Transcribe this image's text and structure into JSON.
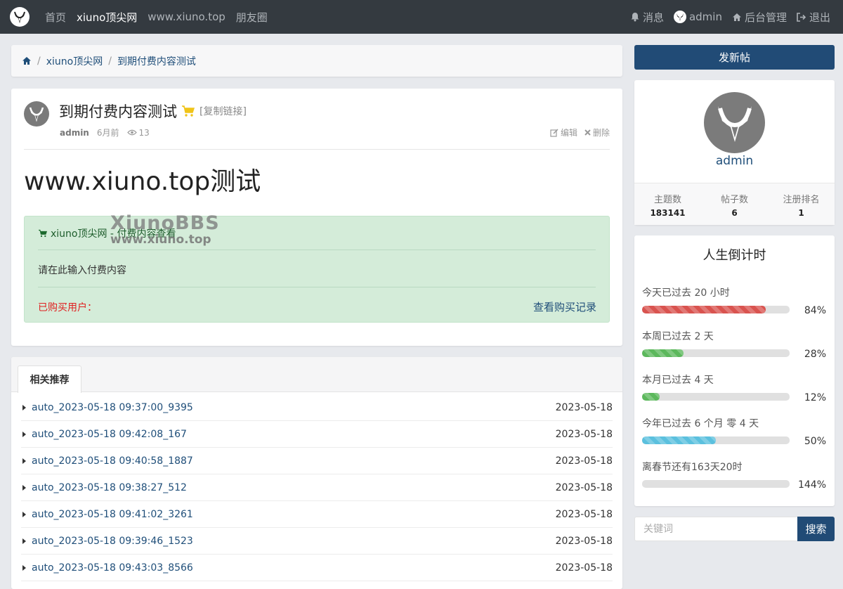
{
  "nav": {
    "logo_icon": "bull-logo-icon",
    "left": [
      "首页",
      "xiuno顶尖网",
      "www.xiuno.top",
      "朋友圈"
    ],
    "messages": "消息",
    "user": "admin",
    "admin": "后台管理",
    "logout": "退出"
  },
  "breadcrumb": {
    "site": "xiuno顶尖网",
    "current": "到期付费内容测试"
  },
  "post": {
    "title": "到期付费内容测试",
    "copy_link": "[复制链接]",
    "author": "admin",
    "time": "6月前",
    "views": "13",
    "edit": "编辑",
    "delete": "删除",
    "body_title": "www.xiuno.top测试",
    "pay": {
      "header": "xiuno顶尖网 - 付费内容查看",
      "content": "请在此输入付费内容",
      "buyers_label": "已购买用户：",
      "record_link": "查看购买记录"
    },
    "watermark": [
      "XiunoBBS",
      "www.xiuno.top"
    ]
  },
  "related": {
    "tab": "相关推荐",
    "items": [
      {
        "title": "auto_2023-05-18 09:37:00_9395",
        "date": "2023-05-18"
      },
      {
        "title": "auto_2023-05-18 09:42:08_167",
        "date": "2023-05-18"
      },
      {
        "title": "auto_2023-05-18 09:40:58_1887",
        "date": "2023-05-18"
      },
      {
        "title": "auto_2023-05-18 09:38:27_512",
        "date": "2023-05-18"
      },
      {
        "title": "auto_2023-05-18 09:41:02_3261",
        "date": "2023-05-18"
      },
      {
        "title": "auto_2023-05-18 09:39:46_1523",
        "date": "2023-05-18"
      },
      {
        "title": "auto_2023-05-18 09:43:03_8566",
        "date": "2023-05-18"
      }
    ]
  },
  "sidebar": {
    "new_post": "发新帖",
    "profile": {
      "name": "admin",
      "stats": [
        {
          "label": "主题数",
          "value": "183141"
        },
        {
          "label": "帖子数",
          "value": "6"
        },
        {
          "label": "注册排名",
          "value": "1"
        }
      ]
    },
    "countdown": {
      "title": "人生倒计时",
      "items": [
        {
          "label": "今天已过去 20 小时",
          "percent_text": "84%",
          "fill": 0.84,
          "color": "#d9534f"
        },
        {
          "label": "本周已过去 2 天",
          "percent_text": "28%",
          "fill": 0.28,
          "color": "#5cb85c"
        },
        {
          "label": "本月已过去 4 天",
          "percent_text": "12%",
          "fill": 0.12,
          "color": "#5cb85c"
        },
        {
          "label": "今年已过去 6 个月 零 4 天",
          "percent_text": "50%",
          "fill": 0.5,
          "color": "#5bc0de"
        },
        {
          "label": "离春节还有163天20时",
          "percent_text": "144%",
          "fill": 0,
          "color": "#cccccc"
        }
      ]
    },
    "search": {
      "placeholder": "关键词",
      "button": "搜索"
    }
  },
  "colors": {
    "navbar": "#343a40",
    "primary": "#214b76",
    "link": "#1f4e79",
    "pay_bg": "#d4ecd9",
    "danger": "#e02020"
  }
}
